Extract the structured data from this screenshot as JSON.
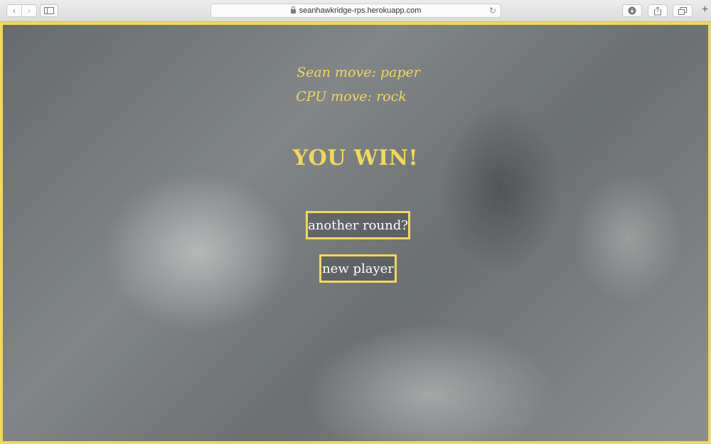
{
  "browser": {
    "url": "seanhawkridge-rps.herokuapp.com",
    "icons": {
      "back": "chevron-left-icon",
      "forward": "chevron-right-icon",
      "sidebar": "sidebar-icon",
      "lock": "lock-icon",
      "reload": "reload-icon",
      "download": "download-icon",
      "share": "share-icon",
      "tabs": "tabs-icon",
      "new_tab": "plus-icon"
    }
  },
  "game": {
    "player_move": "Sean move: paper",
    "cpu_move": "CPU move: rock",
    "result": "YOU WIN!",
    "another_round_label": "another round?",
    "new_player_label": "new player"
  },
  "colors": {
    "accent": "#f1d85a",
    "button_text": "#ffffff"
  }
}
